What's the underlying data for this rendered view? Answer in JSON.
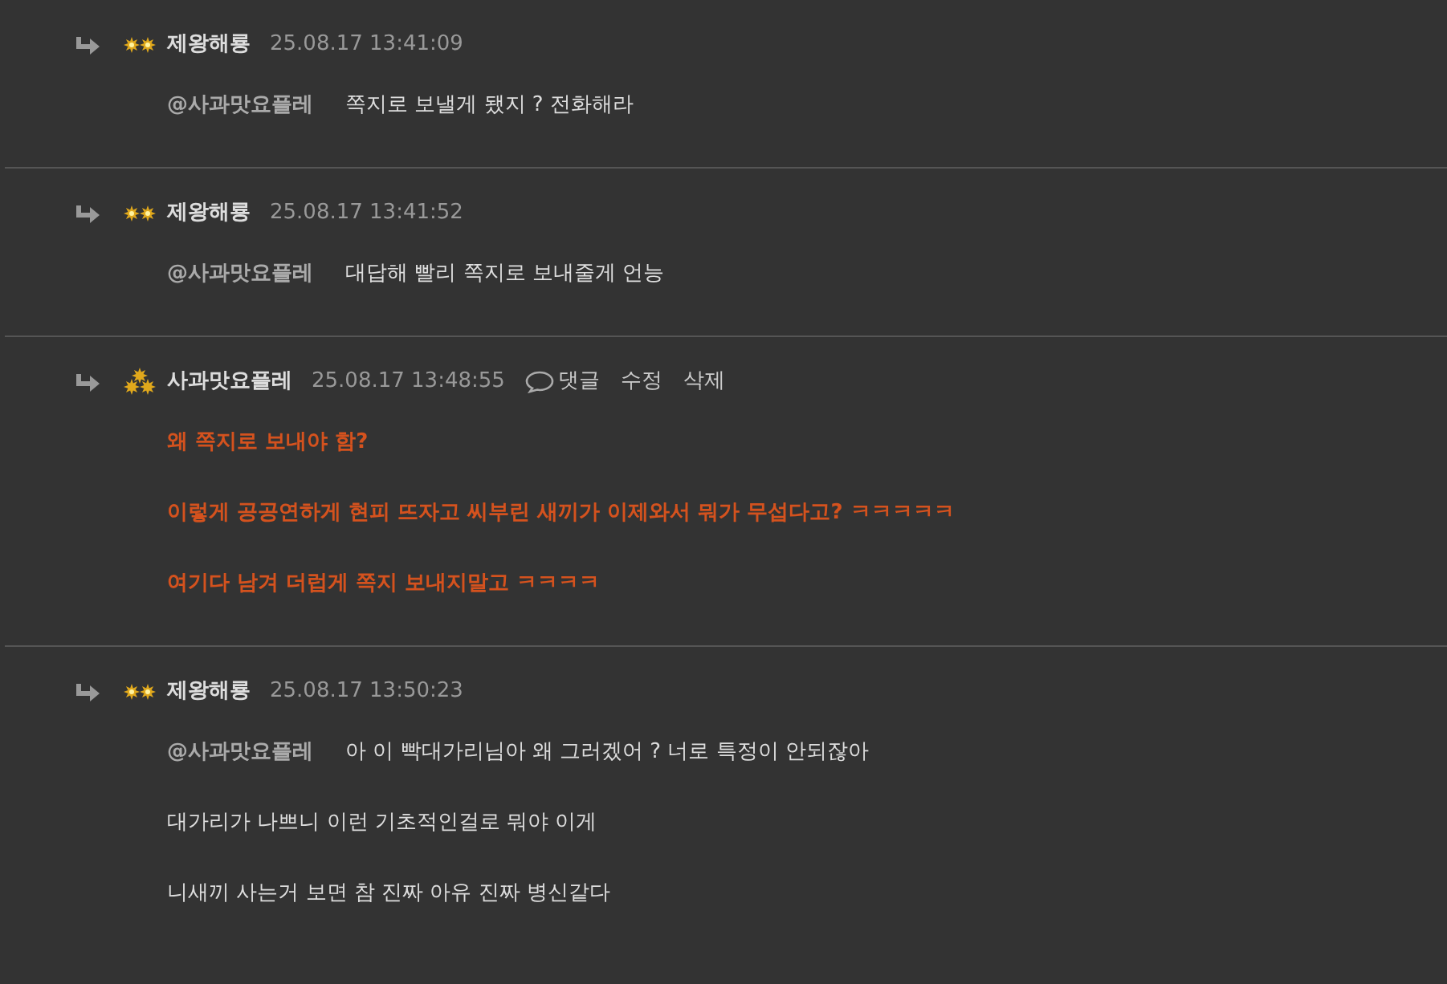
{
  "comments": [
    {
      "author": "제왕해룡",
      "kind": "pair",
      "time": "25.08.17 13:41:09",
      "highlighted": false,
      "paragraphs": [
        {
          "mention": "@사과맛요플레",
          "text": "쪽지로 보낼게 됐지 ? 전화해라"
        }
      ]
    },
    {
      "author": "제왕해룡",
      "kind": "pair",
      "time": "25.08.17 13:41:52",
      "highlighted": false,
      "paragraphs": [
        {
          "mention": "@사과맛요플레",
          "text": "대답해 빨리 쪽지로 보내줄게 언능"
        }
      ]
    },
    {
      "author": "사과맛요플레",
      "kind": "cluster",
      "time": "25.08.17 13:48:55",
      "highlighted": true,
      "actions": [
        {
          "kind": "reply",
          "label": "댓글"
        },
        {
          "kind": "plain",
          "label": "수정"
        },
        {
          "kind": "plain",
          "label": "삭제"
        }
      ],
      "paragraphs": [
        {
          "text": "왜 쪽지로 보내야 함?"
        },
        {
          "text": "이렇게 공공연하게 현피 뜨자고 씨부린 새끼가 이제와서 뭐가 무섭다고? ㅋㅋㅋㅋㅋ"
        },
        {
          "text": "여기다 남겨 더럽게 쪽지 보내지말고 ㅋㅋㅋㅋ"
        }
      ]
    },
    {
      "author": "제왕해룡",
      "kind": "pair",
      "time": "25.08.17 13:50:23",
      "highlighted": false,
      "paragraphs": [
        {
          "mention": "@사과맛요플레",
          "text": "아 이 빡대가리님아 왜 그러겠어 ? 너로 특정이 안되잖아"
        },
        {
          "text": "대가리가 나쁘니 이런 기초적인걸로 뭐야 이게"
        },
        {
          "text": "니새끼 사는거 보면 참 진짜 아유 진짜 병신같다"
        }
      ]
    }
  ]
}
